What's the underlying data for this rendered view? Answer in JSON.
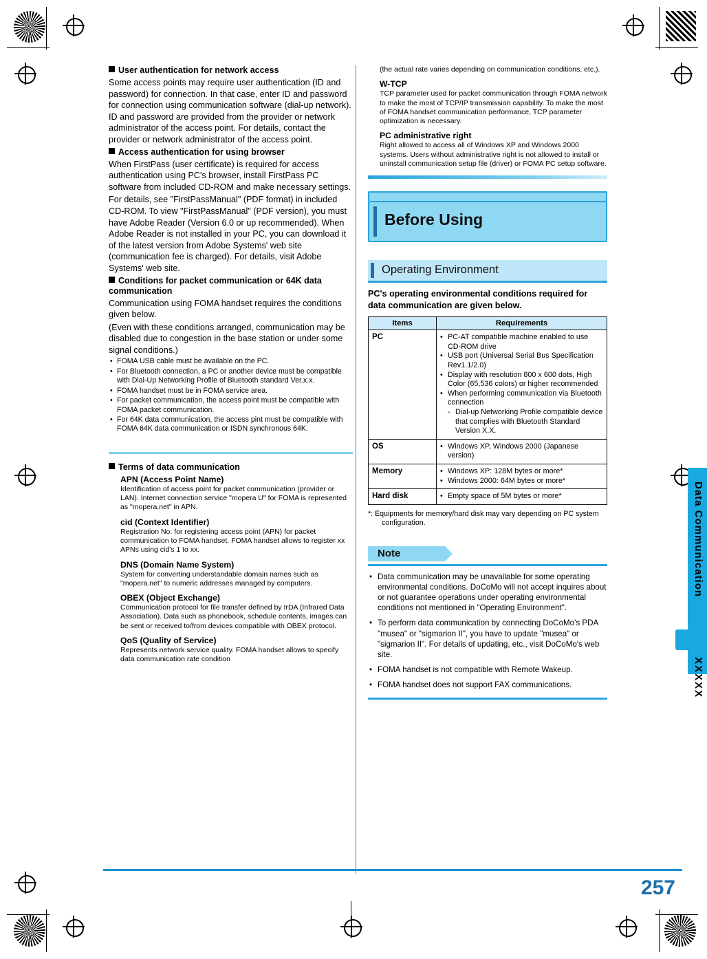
{
  "page": {
    "number": "257",
    "edge_tab_label": "Data Communication",
    "edge_tab_code": "XXXXX"
  },
  "left_column": {
    "sections": [
      {
        "heading": "User authentication for network access",
        "body": "Some access points may require user authentication (ID and password) for connection. In that case, enter ID and password for connection using communication software (dial-up network). ID and password are provided from the provider or network administrator of the access point. For details, contact the provider or network administrator of the access point."
      },
      {
        "heading": "Access authentication for using browser",
        "body": "When FirstPass (user certificate) is required for access authentication using PC's browser, install FirstPass PC software from included CD-ROM and make necessary settings.",
        "body2": "For details, see \"FirstPassManual\" (PDF format) in included CD-ROM. To view \"FirstPassManual\" (PDF version), you must have Adobe Reader (Version 6.0 or up recommended). When Adobe Reader is not installed in your PC, you can download it of the latest version from Adobe Systems' web site (communication fee is charged). For details, visit Adobe Systems' web site."
      },
      {
        "heading": "Conditions for packet communication or 64K data communication",
        "body": "Communication using FOMA handset requires the conditions given below.",
        "body2": "(Even with these conditions arranged, communication may be disabled due to congestion in the base station or under some signal conditions.)",
        "bullets": [
          "FOMA USB cable must be available on the PC.",
          "For Bluetooth connection, a PC or another device must be compatible with Dial-Up Networking Profile of Bluetooth standard Ver.x.x.",
          "FOMA handset must be in FOMA service area.",
          "For packet communication, the access point must be compatible with FOMA packet communication.",
          "For 64K data communication, the access pint must be compatible with FOMA 64K data communication or ISDN synchronous 64K."
        ]
      }
    ],
    "terms_heading": "Terms of data communication",
    "terms": [
      {
        "term": "APN (Access Point Name)",
        "desc": "Identification of access point for packet communication (provider or LAN). Internet connection service \"mopera U\" for FOMA is represented as \"mopera.net\" in APN."
      },
      {
        "term": "cid (Context Identifier)",
        "desc": "Registration No. for registering access point (APN) for packet communication to FOMA handset. FOMA handset allows to register xx APNs using cid's 1 to xx."
      },
      {
        "term": "DNS (Domain Name System)",
        "desc": "System for converting understandable domain names such as \"mopera.net\" to numeric addresses managed by computers."
      },
      {
        "term": "OBEX (Object Exchange)",
        "desc": "Communication protocol for file transfer defined by IrDA (Infrared Data Association). Data such as phonebook, schedule contents, images can be sent or received to/from devices compatible with OBEX protocol."
      },
      {
        "term": "QoS (Quality of Service)",
        "desc": "Represents network service quality. FOMA handset allows to specify data communication rate condition"
      }
    ]
  },
  "right_column": {
    "continuation": "(the actual rate varies depending on communication conditions, etc.).",
    "terms": [
      {
        "term": "W-TCP",
        "desc": "TCP parameter used for packet communication through FOMA network to make the most of TCP/IP transmission capability. To make the most of FOMA handset communication performance, TCP parameter optimization is necessary."
      },
      {
        "term": "PC administrative right",
        "desc": "Right allowed to access all of Windows XP and Windows 2000 systems. Users without administrative right is not allowed to install or uninstall communication setup file (driver) or FOMA PC setup software."
      }
    ],
    "chapter_title": "Before Using",
    "section_title": "Operating Environment",
    "lead": "PC's operating environmental conditions required for data communication are given below.",
    "table": {
      "headers": [
        "Items",
        "Requirements"
      ],
      "rows": [
        {
          "item": "PC",
          "reqs": [
            {
              "text": "PC-AT compatible machine enabled to use CD-ROM drive",
              "sub": false
            },
            {
              "text": "USB port (Universal Serial Bus Specification Rev1.1/2.0)",
              "sub": false
            },
            {
              "text": "Display with resolution 800 x 600 dots, High Color (65,536 colors) or higher recommended",
              "sub": false
            },
            {
              "text": "When performing communication via Bluetooth connection",
              "sub": false
            },
            {
              "text": "Dial-up Networking Profile compatible device that complies with Bluetooth Standard Version X.X.",
              "sub": true
            }
          ]
        },
        {
          "item": "OS",
          "reqs": [
            {
              "text": "Windows XP, Windows 2000 (Japanese version)",
              "sub": false
            }
          ]
        },
        {
          "item": "Memory",
          "reqs": [
            {
              "text": "Windows XP: 128M bytes or more*",
              "sub": false
            },
            {
              "text": "Windows 2000: 64M bytes or more*",
              "sub": false
            }
          ]
        },
        {
          "item": "Hard disk",
          "reqs": [
            {
              "text": "Empty space of 5M bytes or more*",
              "sub": false
            }
          ]
        }
      ]
    },
    "table_footnote": "*:  Equipments for memory/hard disk may vary depending on PC system configuration.",
    "note_label": "Note",
    "notes": [
      "Data communication may be unavailable for some operating environmental conditions. DoCoMo will not accept inquires about or not guarantee operations under operating environmental conditions not mentioned in \"Operating Environment\".",
      "To perform data communication by connecting DoCoMo's PDA \"musea\" or \"sigmarion II\", you have to update \"musea\" or \"sigmarion II\". For details of updating, etc., visit DoCoMo's web site.",
      "FOMA handset is not compatible with Remote Wakeup.",
      "FOMA handset does not support FAX communications."
    ]
  },
  "colors": {
    "accent": "#2aa3dd",
    "chapter_bg": "#8ed8f4",
    "section_bg": "#bfe6f8",
    "tab": "#19a9e0",
    "pagenum": "#1e6fa8"
  }
}
